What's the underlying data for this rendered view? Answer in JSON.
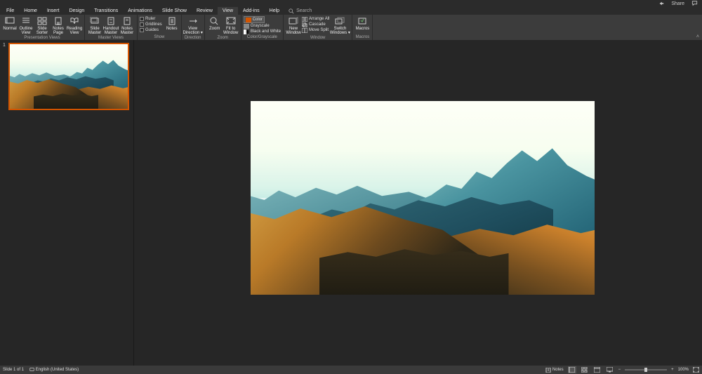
{
  "titlebar": {
    "share": "Share"
  },
  "tabs": [
    "File",
    "Home",
    "Insert",
    "Design",
    "Transitions",
    "Animations",
    "Slide Show",
    "Review",
    "View",
    "Add-ins",
    "Help"
  ],
  "active_tab": "View",
  "tell_me": {
    "placeholder": "Search"
  },
  "ribbon": {
    "presentation_views": {
      "label": "Presentation Views",
      "items": [
        "Normal",
        "Outline\nView",
        "Slide\nSorter",
        "Notes\nPage",
        "Reading\nView"
      ]
    },
    "master_views": {
      "label": "Master Views",
      "items": [
        "Slide\nMaster",
        "Handout\nMaster",
        "Notes\nMaster"
      ]
    },
    "show": {
      "label": "Show",
      "items": [
        "Ruler",
        "Gridlines",
        "Guides"
      ],
      "notes": "Notes"
    },
    "zoom": {
      "label": "Zoom",
      "items": [
        "Zoom",
        "Fit to\nWindow"
      ],
      "direction": "Direction"
    },
    "color_grayscale": {
      "label": "Color/Grayscale",
      "color": "Color",
      "grayscale": "Grayscale",
      "bw": "Black and White"
    },
    "window": {
      "label": "Window",
      "new_window": "New\nWindow",
      "arrange_all": "Arrange All",
      "cascade": "Cascade",
      "move_split": "Move Split",
      "switch": "Switch\nWindows"
    },
    "macros": {
      "label": "Macros",
      "item": "Macros"
    }
  },
  "thumbnails": [
    {
      "number": "1"
    }
  ],
  "statusbar": {
    "slide_info": "Slide 1 of 1",
    "language": "English (United States)",
    "notes": "Notes",
    "zoom_percent": "100%"
  }
}
